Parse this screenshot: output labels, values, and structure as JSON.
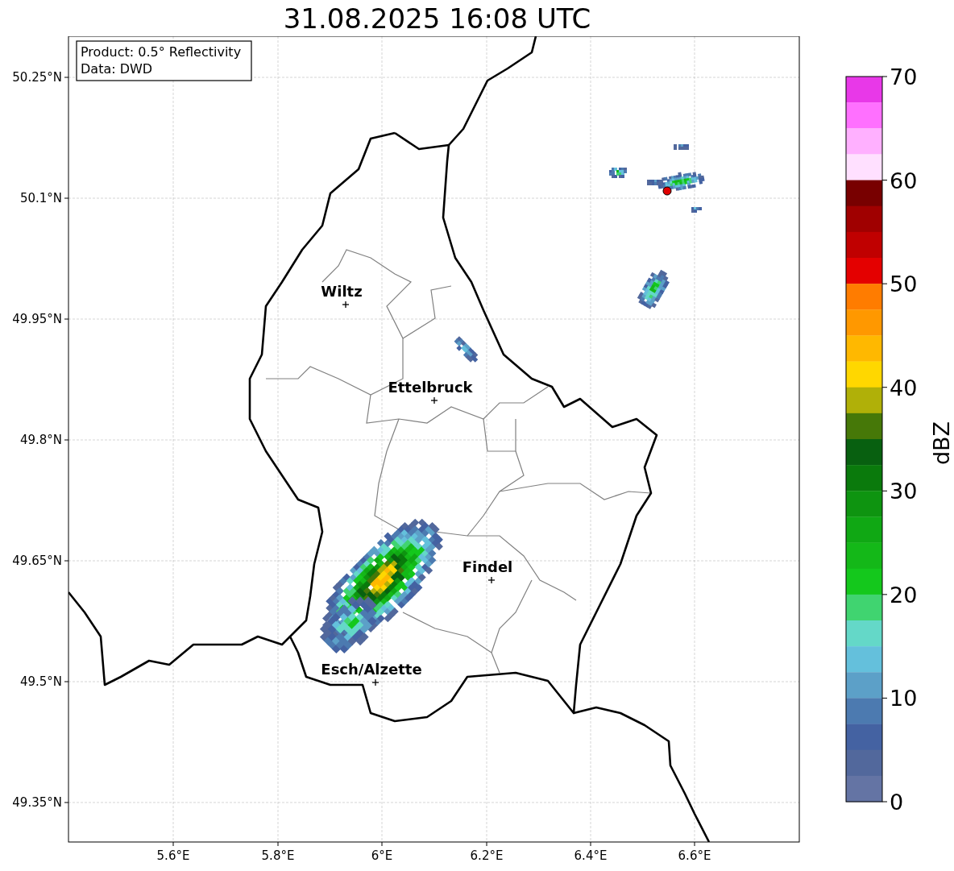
{
  "title": "31.08.2025 16:08 UTC",
  "info_box": [
    "Product: 0.5° Reflectivity",
    "Data: DWD"
  ],
  "cities": [
    {
      "name": "Wiltz"
    },
    {
      "name": "Ettelbruck"
    },
    {
      "name": "Findel"
    },
    {
      "name": "Esch/Alzette"
    }
  ],
  "lat_ticks": [
    "50.25°N",
    "50.1°N",
    "49.95°N",
    "49.8°N",
    "49.65°N",
    "49.5°N",
    "49.35°N"
  ],
  "lon_ticks": [
    "5.6°E",
    "5.8°E",
    "6°E",
    "6.2°E",
    "6.4°E",
    "6.6°E"
  ],
  "colorbar": {
    "label": "dBZ",
    "ticks": [
      "70",
      "60",
      "50",
      "40",
      "30",
      "20",
      "10",
      "0"
    ],
    "segments": [
      {
        "color": "#e838e8"
      },
      {
        "color": "#ff70ff"
      },
      {
        "color": "#ffb0ff"
      },
      {
        "color": "#ffe0ff"
      },
      {
        "color": "#780000"
      },
      {
        "color": "#a00000"
      },
      {
        "color": "#c00000"
      },
      {
        "color": "#e40000"
      },
      {
        "color": "#ff7c00"
      },
      {
        "color": "#ff9800"
      },
      {
        "color": "#ffb800"
      },
      {
        "color": "#ffd700"
      },
      {
        "color": "#b0b008"
      },
      {
        "color": "#467808"
      },
      {
        "color": "#086010"
      },
      {
        "color": "#0a7a0c"
      },
      {
        "color": "#0e9410"
      },
      {
        "color": "#10a814"
      },
      {
        "color": "#14b818"
      },
      {
        "color": "#14c81c"
      },
      {
        "color": "#40d470"
      },
      {
        "color": "#64d8c8"
      },
      {
        "color": "#64c0dc"
      },
      {
        "color": "#5ca0c8"
      },
      {
        "color": "#4c7ab0"
      },
      {
        "color": "#4462a2"
      },
      {
        "color": "#52689c"
      },
      {
        "color": "#6474a4"
      }
    ]
  }
}
